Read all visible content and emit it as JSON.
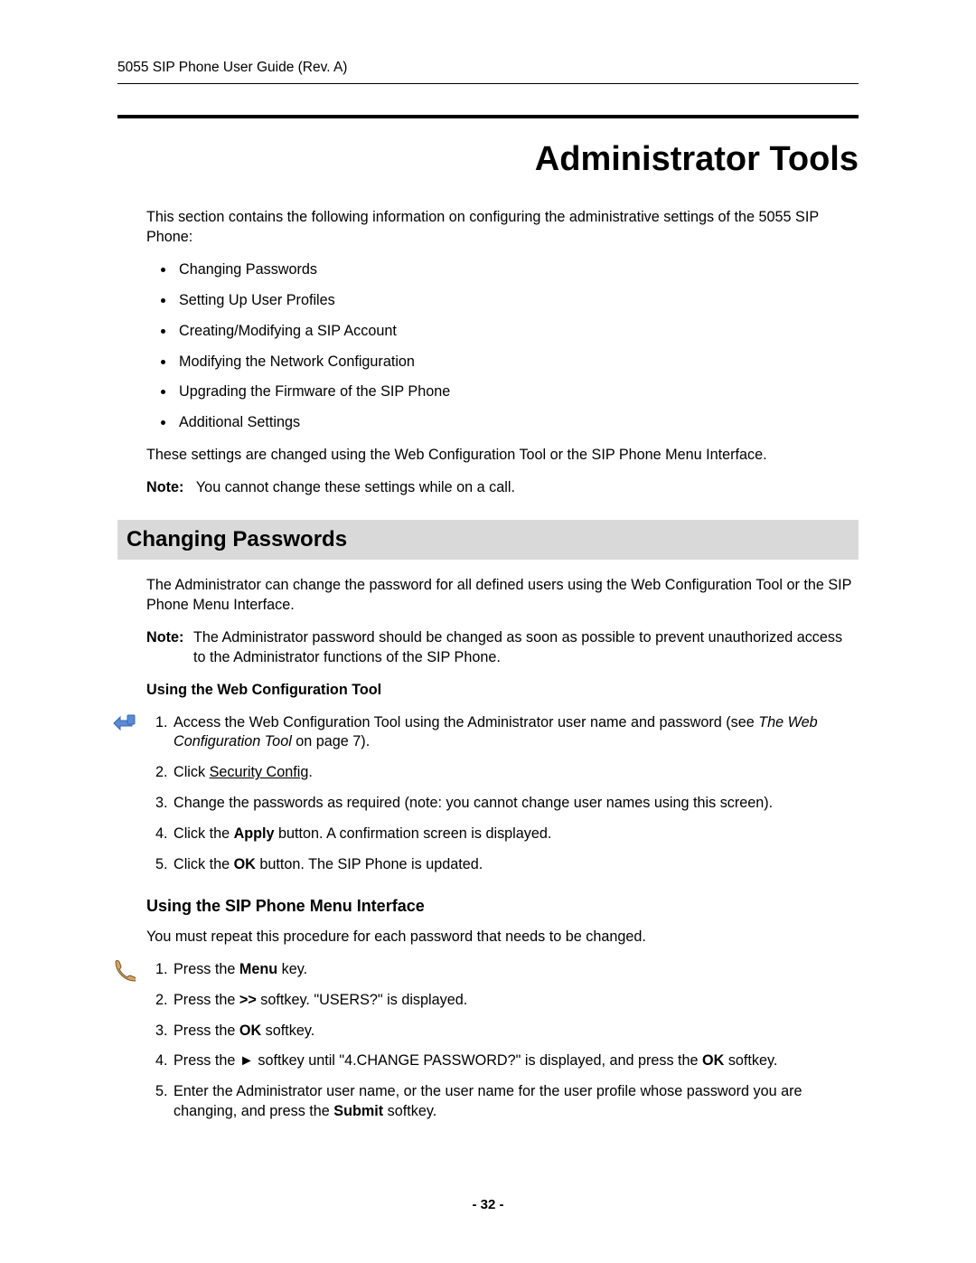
{
  "runningHead": "5055 SIP Phone User Guide (Rev. A)",
  "chapterTitle": "Administrator Tools",
  "introPara": "This section contains the following information on configuring the administrative settings of the 5055 SIP Phone:",
  "topics": [
    "Changing Passwords",
    "Setting Up User Profiles",
    "Creating/Modifying a SIP Account",
    "Modifying the Network Configuration",
    "Upgrading the Firmware of the SIP Phone",
    "Additional Settings"
  ],
  "introPara2": "These settings are changed using the Web Configuration Tool or the SIP Phone Menu Interface.",
  "noteLabel": "Note:",
  "introNote": "You cannot change these settings while on a call.",
  "section1Title": "Changing Passwords",
  "s1Para": "The Administrator can change the password for all defined users using the Web Configuration Tool or the SIP Phone Menu Interface.",
  "s1Note": "The Administrator password should be changed as soon as possible to prevent unauthorized access to the Administrator functions of the SIP Phone.",
  "webHead": "Using the Web Configuration Tool",
  "webSteps": {
    "s1a": "Access the Web Configuration Tool using the Administrator user name and password (see ",
    "s1Ref": "The Web Configuration Tool",
    "s1b": " on page 7).",
    "s2a": "Click ",
    "s2Link": "Security Config",
    "s2b": ".",
    "s3": "Change the passwords as required (note: you cannot change user names using this screen).",
    "s4a": "Click the ",
    "s4Btn": "Apply",
    "s4b": " button. A confirmation screen is displayed.",
    "s5a": "Click the ",
    "s5Btn": "OK",
    "s5b": " button. The SIP Phone is updated."
  },
  "phoneHead": "Using the SIP Phone Menu Interface",
  "phoneIntro": "You must repeat this procedure for each password that needs to be changed.",
  "phoneSteps": {
    "s1a": "Press the ",
    "s1Key": "Menu",
    "s1b": " key.",
    "s2a": "Press the ",
    "s2Key": ">>",
    "s2b": " softkey. \"USERS?\" is displayed.",
    "s3a": "Press the ",
    "s3Key": "OK",
    "s3b": " softkey.",
    "s4a": "Press the ",
    "s4Sym": "►",
    "s4b": " softkey until \"4.CHANGE PASSWORD?\" is displayed, and press the ",
    "s4Key": "OK",
    "s4c": " softkey.",
    "s5a": "Enter the Administrator user name, or the user name for the user profile whose password you are changing, and press the ",
    "s5Key": "Submit",
    "s5b": " softkey."
  },
  "pageNumber": "- 32 -"
}
